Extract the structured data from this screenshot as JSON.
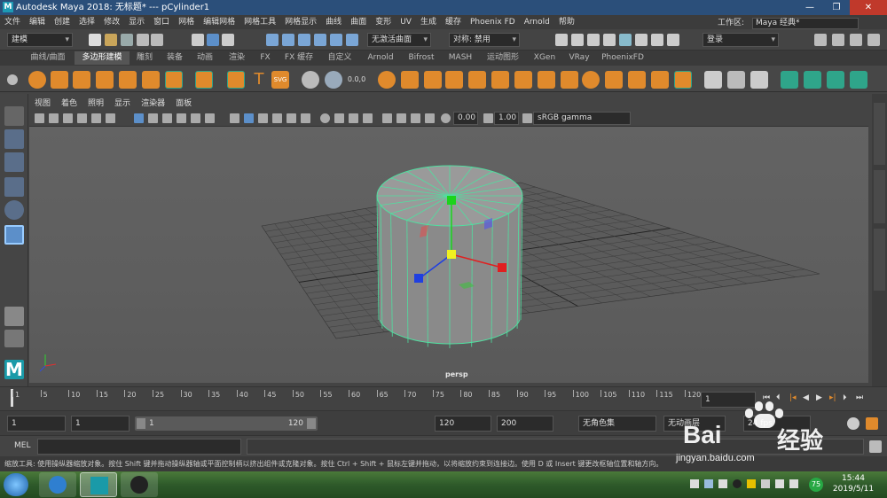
{
  "window": {
    "title": "Autodesk Maya 2018: 无标题*   ---   pCylinder1",
    "app_icon": "M"
  },
  "menubar": {
    "items": [
      "文件",
      "编辑",
      "创建",
      "选择",
      "修改",
      "显示",
      "窗口",
      "网格",
      "编辑网格",
      "网格工具",
      "网格显示",
      "曲线",
      "曲面",
      "变形",
      "UV",
      "生成",
      "缓存",
      "Phoenix FD",
      "Arnold",
      "帮助"
    ]
  },
  "workspace": {
    "label": "工作区:",
    "value": "Maya 经典*"
  },
  "statusline": {
    "mode_menu": "建模",
    "live_surface": "无激活曲面",
    "symmetry": "对称: 禁用",
    "login": "登录"
  },
  "shelf": {
    "tabs": [
      "曲线/曲面",
      "多边形建模",
      "雕刻",
      "装备",
      "动画",
      "渲染",
      "FX",
      "FX 缓存",
      "自定义",
      "Arnold",
      "Bifrost",
      "MASH",
      "运动图形",
      "XGen",
      "VRay",
      "PhoenixFD"
    ],
    "active_tab": "多边形建模",
    "bevel_readout": "0.0,0"
  },
  "panel": {
    "menus": [
      "视图",
      "着色",
      "照明",
      "显示",
      "渲染器",
      "面板"
    ],
    "exposure": "0.00",
    "gamma": "1.00",
    "color_space": "sRGB gamma",
    "camera_label": "persp"
  },
  "timeline": {
    "ticks": [
      "1",
      "5",
      "10",
      "15",
      "20",
      "25",
      "30",
      "35",
      "40",
      "45",
      "50",
      "55",
      "60",
      "65",
      "70",
      "75",
      "80",
      "85",
      "90",
      "95",
      "100",
      "105",
      "110",
      "115",
      "120"
    ],
    "current_frame": "1"
  },
  "range": {
    "start": "1",
    "anim_start": "1",
    "slider_start": "1",
    "slider_end": "120",
    "anim_end": "120",
    "end": "200",
    "char_set": "无角色集",
    "anim_layer": "无动画层",
    "fps": "24 fps"
  },
  "command": {
    "label": "MEL"
  },
  "help": {
    "text": "缩放工具: 使用操纵器缩放对象。按住 Shift 键并拖动操纵器轴或平面控制柄以挤出组件或克隆对象。按住 Ctrl + Shift + 鼠标左键并拖动，以将缩放约束到连接边。使用 D 或 Insert 键更改枢轴位置和轴方向。"
  },
  "taskbar": {
    "time": "15:44",
    "date": "2019/5/11",
    "badge": "75"
  },
  "watermark": {
    "brand": "Bai",
    "brand2": "经验",
    "url": "jingyan.baidu.com"
  },
  "colors": {
    "accent_orange": "#e08a2c",
    "shelf_teal": "#2fa58a",
    "wire_green": "#4fe0a0"
  }
}
